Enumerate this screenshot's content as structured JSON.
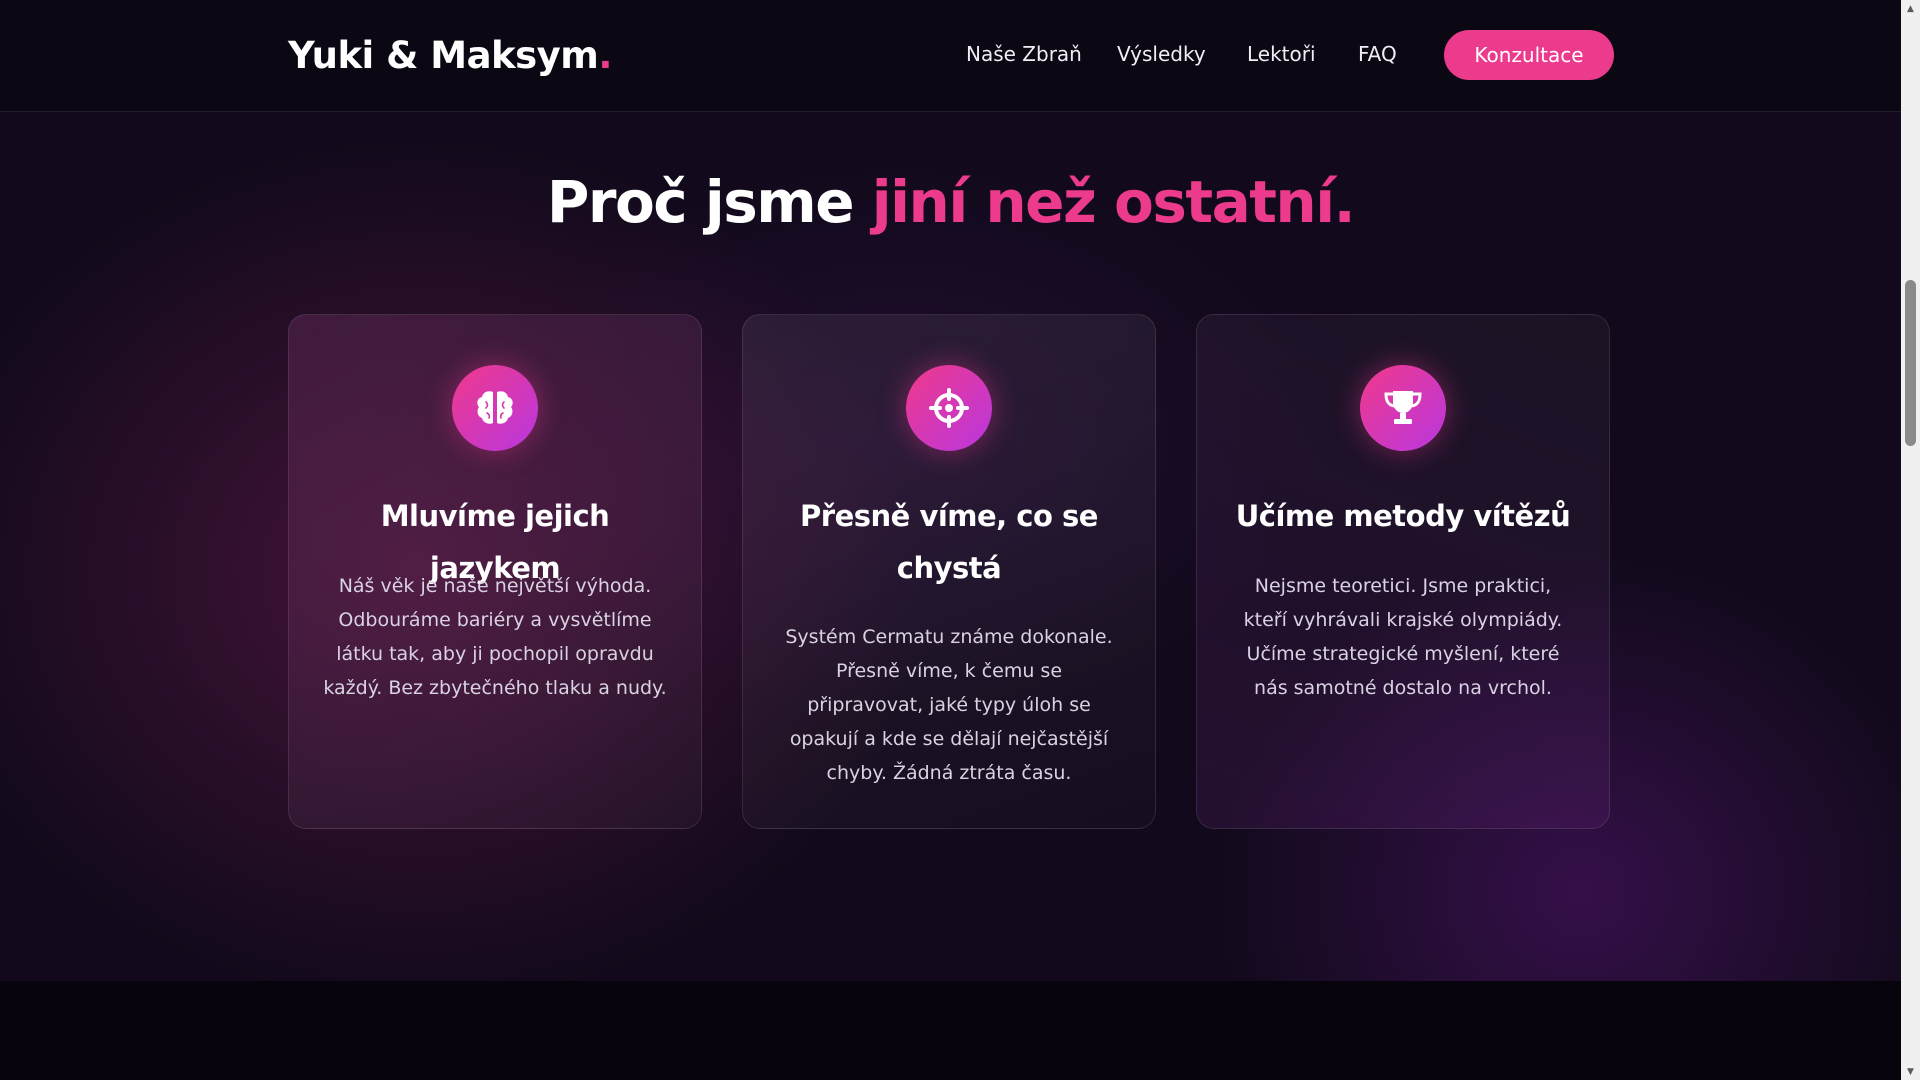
{
  "header": {
    "logo_text": "Yuki & Maksym",
    "logo_dot": ".",
    "nav": [
      {
        "label": "Naše Zbraň"
      },
      {
        "label": "Výsledky"
      },
      {
        "label": "Lektoři"
      },
      {
        "label": "FAQ"
      }
    ],
    "cta_label": "Konzultace"
  },
  "section": {
    "heading_plain": "Proč jsme",
    "heading_accent": "jiní než ostatní.",
    "cards": [
      {
        "icon": "brain-icon",
        "title": "Mluvíme jejich jazykem",
        "text": "Náš věk je naše největší výhoda. Odbouráme bariéry a vysvětlíme látku tak, aby ji pochopil opravdu každý. Bez zbytečného tlaku a nudy."
      },
      {
        "icon": "crosshair-icon",
        "title": "Přesně víme, co se chystá",
        "text": "Systém Cermatu známe dokonale. Přesně víme, k čemu se připravovat, jaké typy úloh se opakují a kde se dělají nejčastější chyby. Žádná ztráta času."
      },
      {
        "icon": "trophy-icon",
        "title": "Učíme metody vítězů",
        "text": "Nejsme teoretici. Jsme praktici, kteří vyhrávali krajské olympiády. Učíme strategické myšlení, které nás samotné dostalo na vrchol."
      }
    ]
  },
  "colors": {
    "accent": "#ec3a8c",
    "background": "#07040d"
  }
}
